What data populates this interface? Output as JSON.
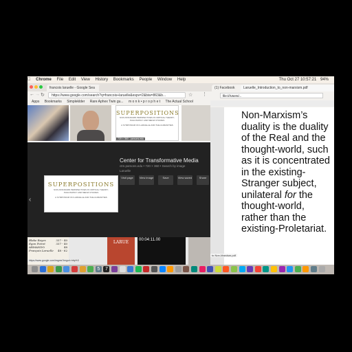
{
  "menubar": {
    "apple": "",
    "app": "Chrome",
    "items": [
      "File",
      "Edit",
      "View",
      "History",
      "Bookmarks",
      "People",
      "Window",
      "Help"
    ],
    "clock": "Thu Oct 27  10:57:21",
    "battery": "94%"
  },
  "left_window": {
    "tabs": [
      {
        "label": "francois laruelle - Google Sea"
      },
      {
        "label": ""
      }
    ],
    "url": "https://www.google.com/search?q=francois+laruelle&espv=2&biw=863&b...",
    "bookmarks": [
      "Apps",
      "Bookmarks",
      "Simpleklder",
      "Rare Aphex Twin gu...",
      "m o n k • p r o p h e t",
      "The Actual School"
    ],
    "superpositions": {
      "title": "SUPERPOSITIONS",
      "subtitle1": "NON-STANDARD PERSPECTIVES IN CRITICAL THEORY,",
      "subtitle2": "PHILOSOPHY AND MEDIA STUDIES",
      "subtitle3": "A SYMPOSIUM ON LARUELLE AND THE HUMANITIES",
      "size": "720 × 360 - parsons.edu"
    },
    "result": {
      "title": "Center for Transformative Media",
      "meta": "ctm.parsons.edu • 720 × 360 • Search by image",
      "tag": "Laruelle",
      "buttons": [
        "Visit page",
        "View image",
        "Save",
        "View saved",
        "Share"
      ]
    },
    "video_time": "00:04:11.00",
    "status_url": "https://www.google.com/imgres?imgurl=http%3",
    "book": {
      "rows": [
        [
          "Blake Reyes",
          "337 - 40"
        ],
        [
          "Egon Poiret",
          "337 - 40"
        ],
        [
          "ARMANDO",
          "48"
        ],
        [
          "François Laruelle",
          "48 - 62"
        ]
      ]
    },
    "book_cover": "LARUE"
  },
  "right_window": {
    "tabs": [
      {
        "label": "(1) Facebook"
      },
      {
        "label": "Laruelle_Introduction_to_non-marxism.pdf"
      }
    ],
    "url": "file:///Users/...",
    "file_label": "to Non-Marxism.pdf",
    "overlay_text": [
      "Non-Marxism’s",
      "duality is the duality",
      "of the Real and the",
      "thought-world, such",
      "as it is concentrated",
      "in the existing-",
      "Stranger subject,",
      "unilateral ",
      "for",
      " the",
      "thought-world,",
      "rather than the",
      "existing-Proletariat."
    ]
  },
  "dock": {
    "colors": [
      "#8e8e8e",
      "#2c6fd6",
      "#d9a21c",
      "#3b9a49",
      "#4a90e2",
      "#d43b3b",
      "#e0a030",
      "#4caf50",
      "#607d8b",
      "#222222",
      "#7b3f9a",
      "#dddddd",
      "#3a7bd5",
      "#1db954",
      "#c62828",
      "#555555",
      "#0a84ff",
      "#ff9800",
      "#9e9e9e",
      "#795548",
      "#00897b",
      "#e91e63",
      "#3f51b5",
      "#cddc39",
      "#ff5722",
      "#8bc34a",
      "#03a9f4",
      "#673ab7",
      "#f44336",
      "#009688",
      "#ffc107",
      "#9c27b0",
      "#2196f3",
      "#4caf50",
      "#ff9800",
      "#607d8b",
      "#aaaaaa"
    ],
    "labels": [
      "5",
      "7"
    ]
  }
}
